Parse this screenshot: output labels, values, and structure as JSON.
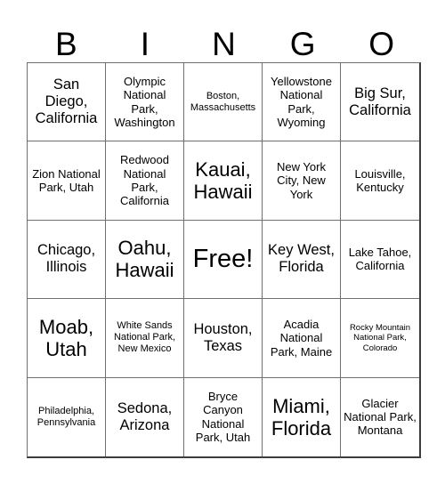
{
  "header": {
    "letters": [
      "B",
      "I",
      "N",
      "G",
      "O"
    ]
  },
  "grid": {
    "columns": 5,
    "rows": 5,
    "cells": [
      {
        "text": "San Diego, California",
        "size": "t-lg"
      },
      {
        "text": "Olympic National Park, Washington",
        "size": "t-md"
      },
      {
        "text": "Boston, Massachusetts",
        "size": "t-sm"
      },
      {
        "text": "Yellowstone National Park, Wyoming",
        "size": "t-md"
      },
      {
        "text": "Big Sur, California",
        "size": "t-lg"
      },
      {
        "text": "Zion National Park, Utah",
        "size": "t-md"
      },
      {
        "text": "Redwood National Park, California",
        "size": "t-md"
      },
      {
        "text": "Kauai, Hawaii",
        "size": "t-xl"
      },
      {
        "text": "New York City, New York",
        "size": "t-md"
      },
      {
        "text": "Louisville, Kentucky",
        "size": "t-md"
      },
      {
        "text": "Chicago, Illinois",
        "size": "t-lg"
      },
      {
        "text": "Oahu, Hawaii",
        "size": "t-xl"
      },
      {
        "text": "Free!",
        "size": "t-xxl"
      },
      {
        "text": "Key West, Florida",
        "size": "t-lg"
      },
      {
        "text": "Lake Tahoe, California",
        "size": "t-md"
      },
      {
        "text": "Moab, Utah",
        "size": "t-xl"
      },
      {
        "text": "White Sands National Park, New Mexico",
        "size": "t-sm"
      },
      {
        "text": "Houston, Texas",
        "size": "t-lg"
      },
      {
        "text": "Acadia National Park, Maine",
        "size": "t-md"
      },
      {
        "text": "Rocky Mountain National Park, Colorado",
        "size": "t-xs"
      },
      {
        "text": "Philadelphia, Pennsylvania",
        "size": "t-sm"
      },
      {
        "text": "Sedona, Arizona",
        "size": "t-lg"
      },
      {
        "text": "Bryce Canyon National Park, Utah",
        "size": "t-md"
      },
      {
        "text": "Miami, Florida",
        "size": "t-xl"
      },
      {
        "text": "Glacier National Park, Montana",
        "size": "t-md"
      }
    ]
  },
  "colors": {
    "background": "#ffffff",
    "text": "#000000",
    "grid_line": "#6f6f6f",
    "grid_outer": "#3d3d3d"
  }
}
